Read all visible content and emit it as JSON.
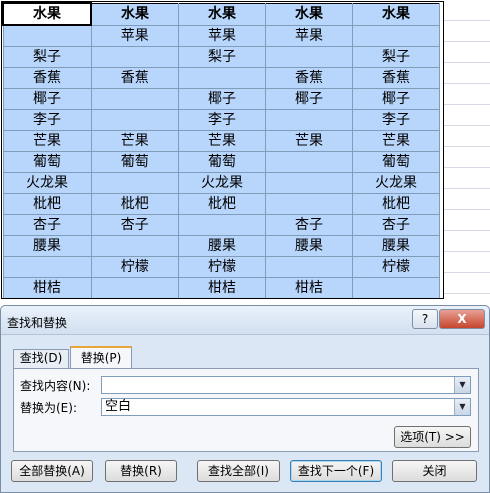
{
  "sheet": {
    "rows": [
      [
        "水果",
        "水果",
        "水果",
        "水果",
        "水果"
      ],
      [
        "",
        "苹果",
        "苹果",
        "苹果",
        ""
      ],
      [
        "梨子",
        "",
        "梨子",
        "",
        "梨子"
      ],
      [
        "香蕉",
        "香蕉",
        "",
        "香蕉",
        "香蕉"
      ],
      [
        "椰子",
        "",
        "椰子",
        "椰子",
        "椰子"
      ],
      [
        "李子",
        "",
        "李子",
        "",
        "李子"
      ],
      [
        "芒果",
        "芒果",
        "芒果",
        "芒果",
        "芒果"
      ],
      [
        "葡萄",
        "葡萄",
        "葡萄",
        "",
        "葡萄"
      ],
      [
        "火龙果",
        "",
        "火龙果",
        "",
        "火龙果"
      ],
      [
        "枇杷",
        "枇杷",
        "枇杷",
        "",
        "枇杷"
      ],
      [
        "杏子",
        "杏子",
        "",
        "杏子",
        "杏子"
      ],
      [
        "腰果",
        "",
        "腰果",
        "腰果",
        "腰果"
      ],
      [
        "",
        "柠檬",
        "柠檬",
        "",
        "柠檬"
      ],
      [
        "柑桔",
        "",
        "柑桔",
        "柑桔",
        ""
      ]
    ],
    "selection_color": "#b8d6fb"
  },
  "dialog": {
    "title": "查找和替换",
    "help_label": "?",
    "close_label": "X",
    "tabs": [
      {
        "label": "查找(D)",
        "active": false
      },
      {
        "label": "替换(P)",
        "active": true
      }
    ],
    "find_label": "查找内容(N):",
    "find_value": "",
    "replace_label": "替换为(E):",
    "replace_value": "空白",
    "options_button": "选项(T) >>",
    "buttons": {
      "replace_all": "全部替换(A)",
      "replace": "替换(R)",
      "find_all": "查找全部(I)",
      "find_next": "查找下一个(F)",
      "close": "关闭"
    }
  }
}
